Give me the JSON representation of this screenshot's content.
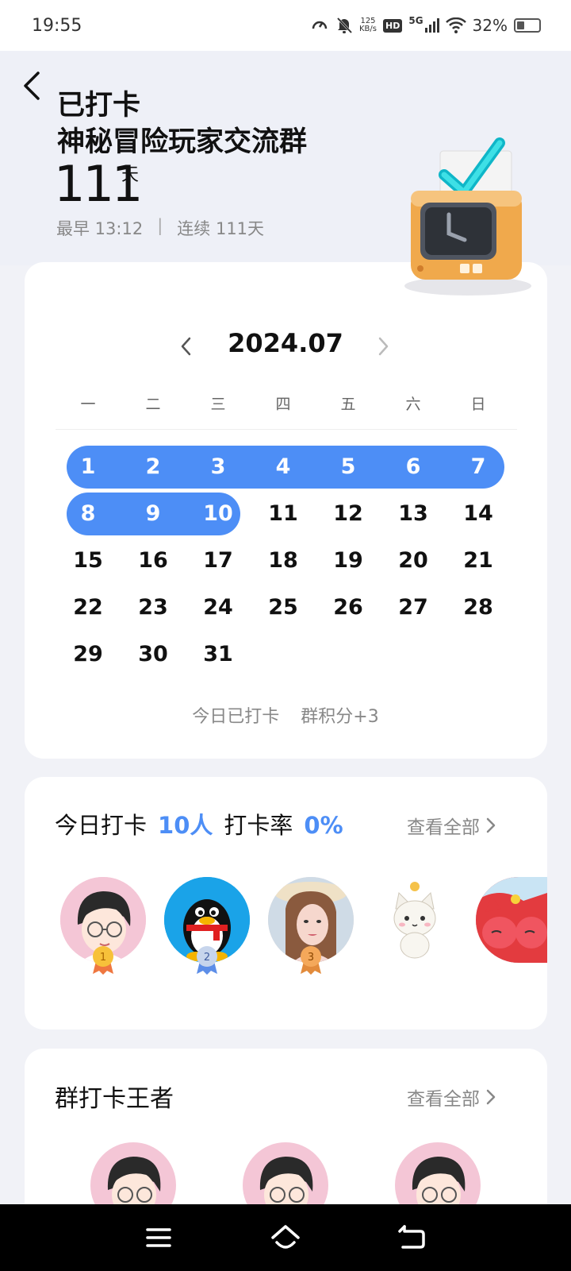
{
  "status_bar": {
    "time": "19:55",
    "net_speed_value": "125",
    "net_speed_unit": "KB/s",
    "hd_label": "HD",
    "network_label": "5G",
    "battery_percent": "32%",
    "battery_level": 0.32
  },
  "header": {
    "title_line1": "已打卡",
    "title_line2": "神秘冒险玩家交流群",
    "days_count": "111",
    "days_unit": "天",
    "earliest": "最早 13:12",
    "separator": "|",
    "streak": "连续 111天"
  },
  "calendar": {
    "month": "2024.07",
    "weekdays": [
      "一",
      "二",
      "三",
      "四",
      "五",
      "六",
      "日"
    ],
    "days": [
      "1",
      "2",
      "3",
      "4",
      "5",
      "6",
      "7",
      "8",
      "9",
      "10",
      "11",
      "12",
      "13",
      "14",
      "15",
      "16",
      "17",
      "18",
      "19",
      "20",
      "21",
      "22",
      "23",
      "24",
      "25",
      "26",
      "27",
      "28",
      "29",
      "30",
      "31"
    ],
    "checked_days": [
      1,
      2,
      3,
      4,
      5,
      6,
      7,
      8,
      9,
      10
    ],
    "first_weekday_index": 0,
    "today_status": "今日已打卡",
    "points": "群积分+3"
  },
  "today_checkin": {
    "label": "今日打卡",
    "count": "10人",
    "rate_label": "打卡率",
    "rate": "0%",
    "view_all": "查看全部",
    "avatars": [
      {
        "name": "avatar-1",
        "rank": "1",
        "icon": "cartoon-boy-glasses"
      },
      {
        "name": "avatar-2",
        "rank": "2",
        "icon": "qq-penguin"
      },
      {
        "name": "avatar-3",
        "rank": "3",
        "icon": "girl-photo"
      },
      {
        "name": "avatar-4",
        "rank": "",
        "icon": "white-cat"
      },
      {
        "name": "avatar-5",
        "rank": "",
        "icon": "red-fox-cartoon"
      }
    ]
  },
  "group_kings": {
    "title": "群打卡王者",
    "view_all": "查看全部"
  },
  "colors": {
    "accent": "#4d8ef6",
    "background": "#f1f2f7",
    "muted": "#888888"
  }
}
